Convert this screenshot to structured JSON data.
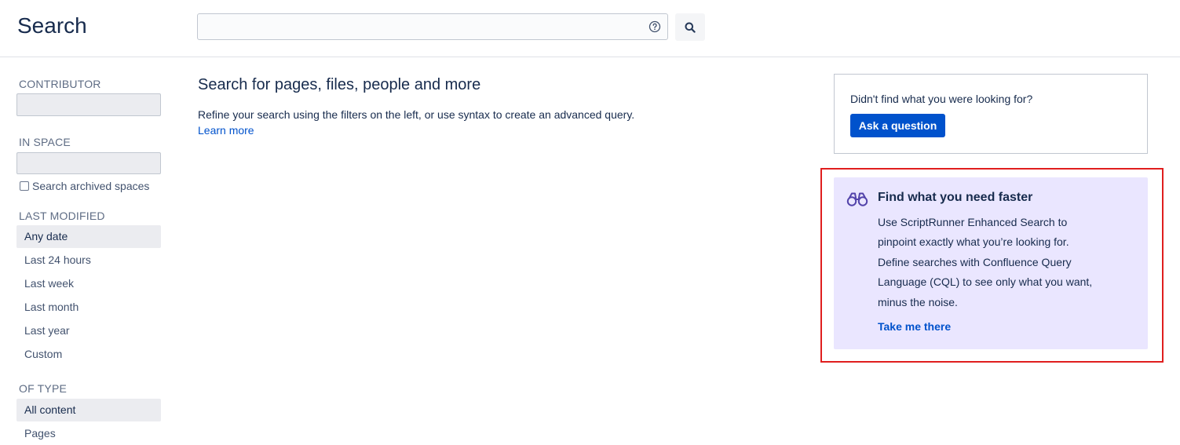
{
  "header": {
    "title": "Search",
    "search": {
      "value": "",
      "placeholder": ""
    },
    "help_icon": "help-icon",
    "search_icon": "search-icon"
  },
  "sidebar": {
    "contributor": {
      "heading": "CONTRIBUTOR",
      "value": ""
    },
    "in_space": {
      "heading": "IN SPACE",
      "value": "",
      "archived_label": "Search archived spaces",
      "archived_checked": false
    },
    "last_modified": {
      "heading": "LAST MODIFIED",
      "options": [
        "Any date",
        "Last 24 hours",
        "Last week",
        "Last month",
        "Last year",
        "Custom"
      ],
      "selected": "Any date"
    },
    "of_type": {
      "heading": "OF TYPE",
      "options": [
        "All content",
        "Pages"
      ],
      "selected": "All content"
    }
  },
  "main": {
    "heading": "Search for pages, files, people and more",
    "text": "Refine your search using the filters on the left, or use syntax to create an advanced query.",
    "learn_more": "Learn more"
  },
  "question_panel": {
    "text": "Didn't find what you were looking for?",
    "button": "Ask a question",
    "button_color": "#0052cc"
  },
  "promo": {
    "icon": "binoculars-icon",
    "title": "Find what you need faster",
    "body_lines": [
      "Use ScriptRunner Enhanced Search to",
      "pinpoint exactly what you’re looking for.",
      "Define searches with Confluence Query",
      "Language (CQL) to see only what you want,",
      "minus the noise."
    ],
    "link": "Take me there",
    "background": "#eae6ff",
    "highlight_color": "#e01e1e"
  }
}
